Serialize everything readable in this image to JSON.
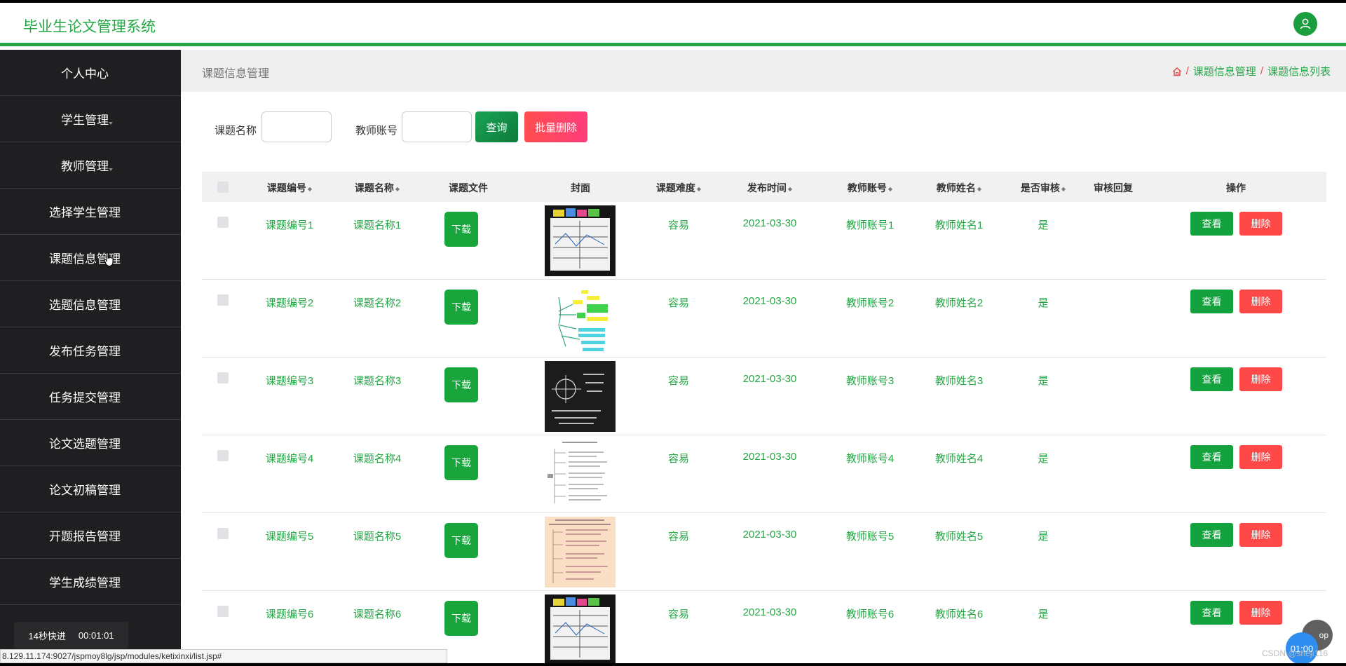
{
  "header": {
    "title": "毕业生论文管理系统",
    "avatar_icon": "user-icon"
  },
  "sidebar": {
    "items": [
      {
        "label": "个人中心",
        "caret": false
      },
      {
        "label": "学生管理",
        "caret": true
      },
      {
        "label": "教师管理",
        "caret": true
      },
      {
        "label": "选择学生管理",
        "caret": true
      },
      {
        "label": "课题信息管理",
        "caret": true
      },
      {
        "label": "选题信息管理",
        "caret": true
      },
      {
        "label": "发布任务管理",
        "caret": true
      },
      {
        "label": "任务提交管理",
        "caret": true
      },
      {
        "label": "论文选题管理",
        "caret": true
      },
      {
        "label": "论文初稿管理",
        "caret": true
      },
      {
        "label": "开题报告管理",
        "caret": true
      },
      {
        "label": "学生成绩管理",
        "caret": true
      }
    ]
  },
  "page": {
    "title": "课题信息管理",
    "breadcrumb": [
      "课题信息管理",
      "课题信息列表"
    ]
  },
  "search": {
    "label1": "课题名称",
    "value1": "",
    "label2": "教师账号",
    "value2": "",
    "query_label": "查询",
    "batch_delete_label": "批量删除"
  },
  "table": {
    "headers": {
      "code": "课题编号",
      "name": "课题名称",
      "file": "课题文件",
      "cover": "封面",
      "difficulty": "课题难度",
      "time": "发布时间",
      "teacher_account": "教师账号",
      "teacher_name": "教师姓名",
      "reviewed": "是否审核",
      "reply": "审核回复",
      "ops": "操作"
    },
    "download_label": "下载",
    "view_label": "查看",
    "delete_label": "删除",
    "rows": [
      {
        "code": "课题编号1",
        "name": "课题名称1",
        "difficulty": "容易",
        "time": "2021-03-30",
        "teacher_account": "教师账号1",
        "teacher_name": "教师姓名1",
        "reviewed": "是",
        "reply": ""
      },
      {
        "code": "课题编号2",
        "name": "课题名称2",
        "difficulty": "容易",
        "time": "2021-03-30",
        "teacher_account": "教师账号2",
        "teacher_name": "教师姓名2",
        "reviewed": "是",
        "reply": ""
      },
      {
        "code": "课题编号3",
        "name": "课题名称3",
        "difficulty": "容易",
        "time": "2021-03-30",
        "teacher_account": "教师账号3",
        "teacher_name": "教师姓名3",
        "reviewed": "是",
        "reply": ""
      },
      {
        "code": "课题编号4",
        "name": "课题名称4",
        "difficulty": "容易",
        "time": "2021-03-30",
        "teacher_account": "教师账号4",
        "teacher_name": "教师姓名4",
        "reviewed": "是",
        "reply": ""
      },
      {
        "code": "课题编号5",
        "name": "课题名称5",
        "difficulty": "容易",
        "time": "2021-03-30",
        "teacher_account": "教师账号5",
        "teacher_name": "教师姓名5",
        "reviewed": "是",
        "reply": ""
      },
      {
        "code": "课题编号6",
        "name": "课题名称6",
        "difficulty": "容易",
        "time": "2021-03-30",
        "teacher_account": "教师账号6",
        "teacher_name": "教师姓名6",
        "reviewed": "是",
        "reply": ""
      }
    ]
  },
  "overlay": {
    "speed_text": "14秒快进",
    "speed_time": "00:01:01",
    "status_url": "8.129.11.174:9027/jspmoy8lg/jsp/modules/ketixinxi/list.jsp#",
    "timer": "01:00",
    "top_label": "op",
    "watermark": "CSDN @shejı116"
  },
  "colors": {
    "accent": "#23a744",
    "sidebar_bg": "#1f1f21",
    "danger": "#ff4848"
  }
}
